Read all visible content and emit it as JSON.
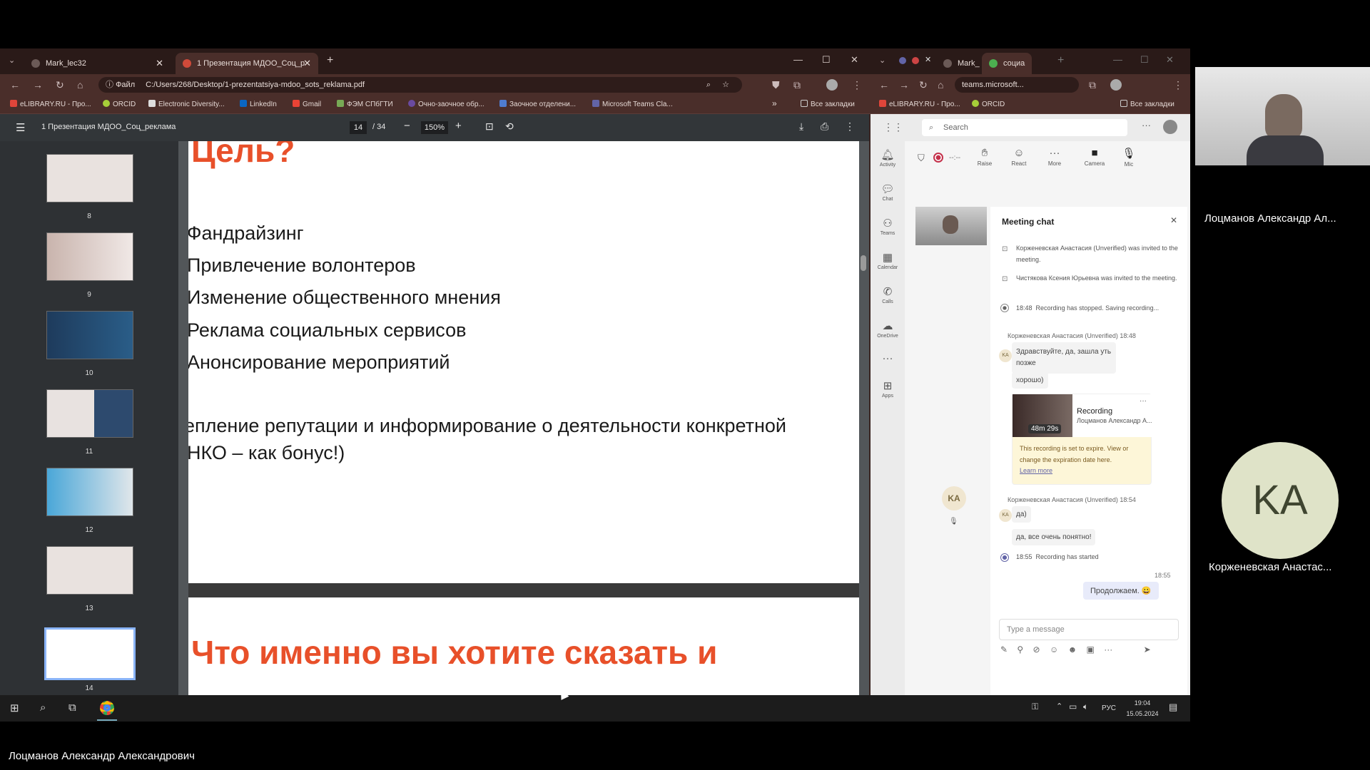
{
  "left_browser": {
    "tabs": [
      {
        "label": "Mark_lec32"
      },
      {
        "label": "1 Презентация МДОО_Соц_р"
      }
    ],
    "address_prefix": "Файл",
    "address": "C:/Users/268/Desktop/1-prezentatsiya-mdoo_sots_reklama.pdf",
    "bookmarks": [
      "eLIBRARY.RU - Про...",
      "ORCID",
      "Electronic Diversity...",
      "LinkedIn",
      "Gmail",
      "ФЭМ СПбГТИ",
      "Очно-заочное обр...",
      "Заочное отделени...",
      "Microsoft Teams Cla..."
    ],
    "bookmarks_more": "»",
    "all_bookmarks": "Все закладки"
  },
  "pdf": {
    "title": "1 Презентация МДОО_Соц_реклама",
    "page": "14",
    "page_total": "/ 34",
    "zoom": "150%",
    "thumb_numbers": [
      "8",
      "9",
      "10",
      "11",
      "12",
      "13",
      "14"
    ],
    "slide_title": "Цель?",
    "bullets": [
      "Фандрайзинг",
      "Привлечение волонтеров",
      "Изменение общественного мнения",
      "Реклама социальных сервисов",
      "Анонсирование мероприятий"
    ],
    "extra_line1": "еплeние репутации и информирование о деятельности конкретной",
    "extra_line2": "НКО – как бонус!)",
    "next_title": "Что именно вы хотите сказать и"
  },
  "right_browser": {
    "tabs": [
      {
        "label": "Mark_"
      },
      {
        "label": "социа"
      }
    ],
    "address": "teams.microsoft...",
    "bookmarks": [
      "eLIBRARY.RU - Про...",
      "ORCID"
    ],
    "all_bookmarks": "Все закладки"
  },
  "teams": {
    "search_placeholder": "Search",
    "rail": [
      "Activity",
      "Chat",
      "Teams",
      "Calendar",
      "Calls",
      "OneDrive",
      "Apps"
    ],
    "timer": "--:--",
    "toolbar": [
      "Raise",
      "React",
      "More",
      "Camera",
      "Mic"
    ],
    "chat_title": "Meeting chat",
    "avatar_initials": "KA",
    "messages": {
      "m1": "Корженевская Анастасия (Unverified) was invited to the meeting.",
      "m2": "Чистякова Ксения Юрьевна was invited to the meeting.",
      "m3_time": "18:48",
      "m3": "Recording has stopped. Saving recording...",
      "sender1": "Корженевская Анастасия (Unverified)  18:48",
      "b1": "Здравствуйте, да, зашла уть позже",
      "b2": "хорошо)",
      "rec_title": "Recording",
      "rec_author": "Лоцманов Александр А...",
      "rec_duration": "48m 29s",
      "rec_note": "This recording is set to expire. View or change the expiration date here.",
      "rec_learn": "Learn more",
      "sender2": "Корженевская Анастасия (Unverified)  18:54",
      "b3": "да)",
      "b4": "да, все очень понятно!",
      "m4_time": "18:55",
      "m4": "Recording has started",
      "own_time": "18:55",
      "own": "Продолжаем. 😀"
    },
    "input_placeholder": "Type a message"
  },
  "taskbar": {
    "lang": "РУС",
    "time": "19:04",
    "date": "15.05.2024"
  },
  "participants": {
    "p1_name": "Лоцманов Александр Ал...",
    "p2_initials": "KA",
    "p2_name": "Корженевская Анастас...",
    "bottom_name": "Лоцманов Александр Александрович"
  }
}
